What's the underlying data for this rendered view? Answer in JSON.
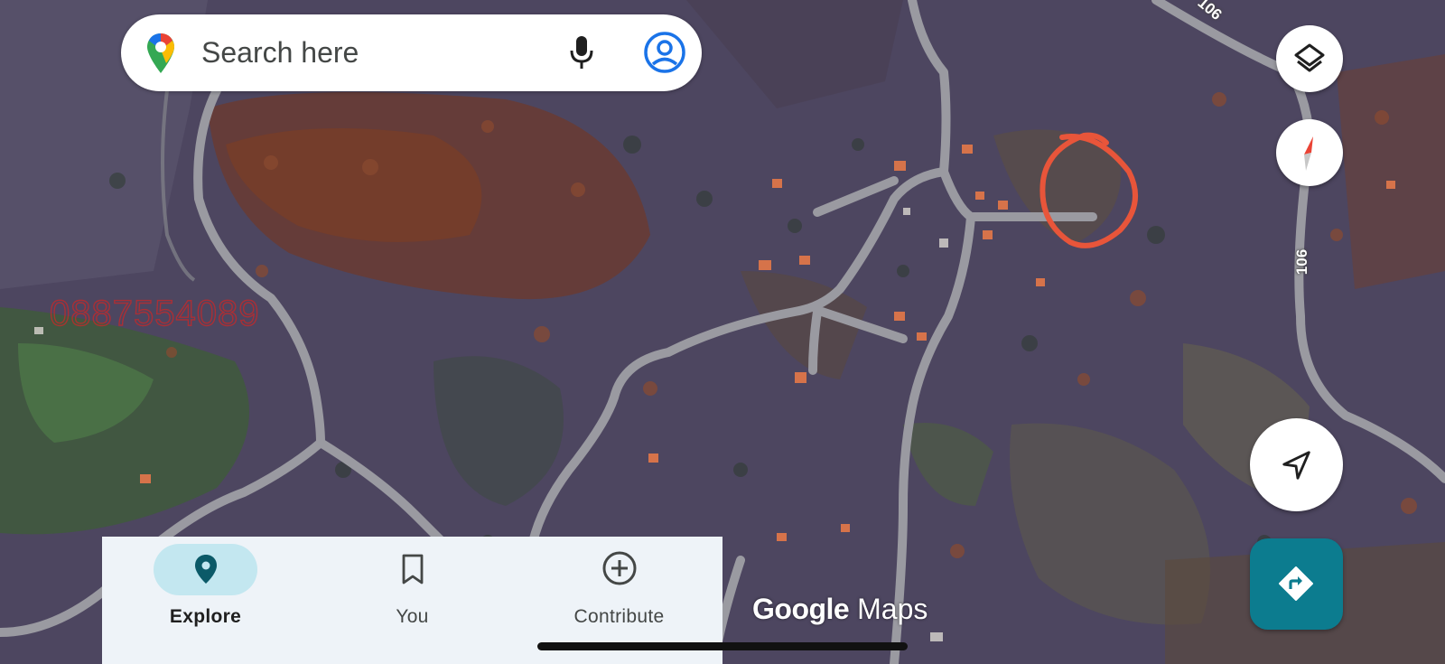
{
  "search": {
    "placeholder": "Search here"
  },
  "map": {
    "type": "satellite",
    "watermark": "0887554089",
    "road_labels": [
      "106",
      "106"
    ],
    "marker": {
      "shape": "hand-drawn-circle",
      "color": "#e8553a"
    }
  },
  "controls": {
    "layers_icon": "layers-icon",
    "compass_icon": "compass-icon",
    "locate_icon": "navigation-arrow-icon",
    "directions_icon": "directions-icon",
    "directions_color": "#0c7c8f"
  },
  "bottom_nav": {
    "items": [
      {
        "label": "Explore",
        "icon": "pin-icon",
        "active": true
      },
      {
        "label": "You",
        "icon": "bookmark-icon",
        "active": false
      },
      {
        "label": "Contribute",
        "icon": "plus-circle-icon",
        "active": false
      }
    ]
  },
  "brand": {
    "google": "Google",
    "maps": "Maps"
  }
}
